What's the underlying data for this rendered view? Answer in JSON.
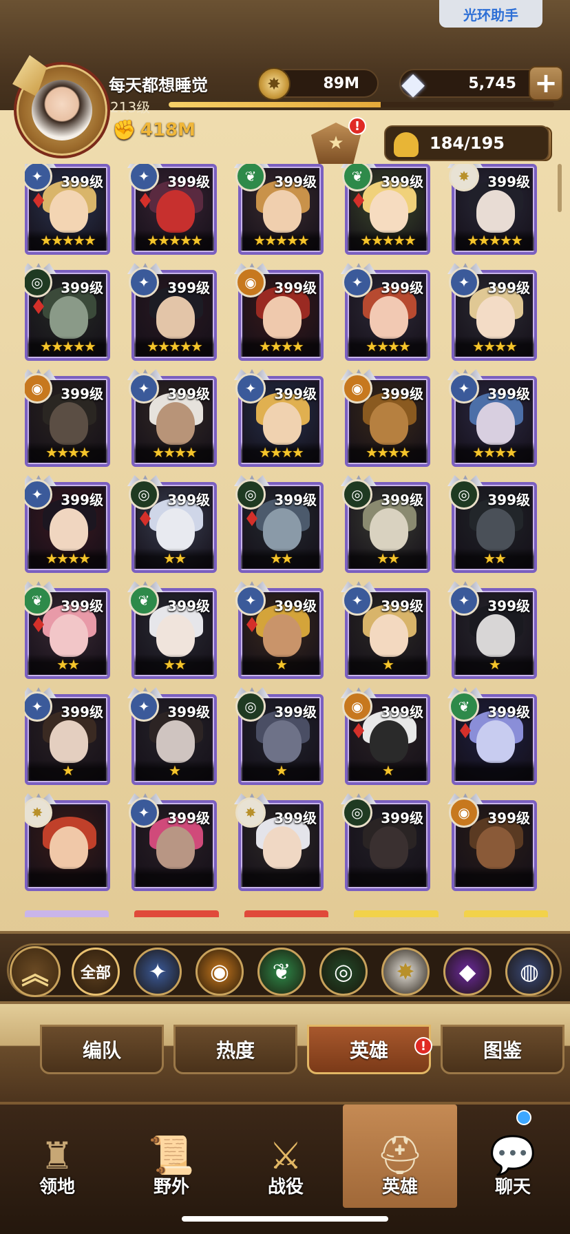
{
  "halo_button": "光环助手",
  "player": {
    "name": "每天都想睡觉",
    "level": "213级",
    "xp_fraction": 0.55,
    "power": "418M"
  },
  "resources": {
    "gold": "89M",
    "diamonds": "5,745"
  },
  "hero_capacity": "184/195",
  "rank_badge": "!",
  "heroes": [
    {
      "level": "399级",
      "stars": "★★★★★",
      "faction": "lightbearer",
      "skin": "#f3d5b3",
      "hair": "#d9b56a",
      "bg": "#2b3550",
      "gem": true
    },
    {
      "level": "399级",
      "stars": "★★★★★",
      "faction": "lightbearer",
      "skin": "#c7302e",
      "hair": "#5a2a40",
      "bg": "#3a2535",
      "gem": true
    },
    {
      "level": "399级",
      "stars": "★★★★★",
      "faction": "wilder",
      "skin": "#f0cfae",
      "hair": "#c9924a",
      "bg": "#3a2c30",
      "gem": false
    },
    {
      "level": "399级",
      "stars": "★★★★★",
      "faction": "wilder",
      "skin": "#f6dcc0",
      "hair": "#f0d17a",
      "bg": "#3d4a2c",
      "gem": true
    },
    {
      "level": "399级",
      "stars": "★★★★★",
      "faction": "celestial",
      "skin": "#e8dcd4",
      "hair": "#20202a",
      "bg": "#2a2a3a",
      "gem": false
    },
    {
      "level": "399级",
      "stars": "★★★★★",
      "faction": "graveborn",
      "skin": "#8a9a88",
      "hair": "#3b4a3a",
      "bg": "#252a25",
      "gem": true
    },
    {
      "level": "399级",
      "stars": "★★★★★",
      "faction": "lightbearer",
      "skin": "#e3c5a8",
      "hair": "#1c1c24",
      "bg": "#2a1a22",
      "gem": false
    },
    {
      "level": "399级",
      "stars": "★★★★",
      "faction": "mauler",
      "skin": "#efc9ad",
      "hair": "#9a2a22",
      "bg": "#3a1a1a",
      "gem": false
    },
    {
      "level": "399级",
      "stars": "★★★★",
      "faction": "lightbearer",
      "skin": "#f2c9b3",
      "hair": "#b74a30",
      "bg": "#2e2a38",
      "gem": false
    },
    {
      "level": "399级",
      "stars": "★★★★",
      "faction": "lightbearer",
      "skin": "#f3dcc6",
      "hair": "#e0c894",
      "bg": "#2c2c34",
      "gem": false
    },
    {
      "level": "399级",
      "stars": "★★★★",
      "faction": "mauler",
      "skin": "#5b4e44",
      "hair": "#2a2622",
      "bg": "#2a2420",
      "gem": false
    },
    {
      "level": "399级",
      "stars": "★★★★",
      "faction": "lightbearer",
      "skin": "#b89478",
      "hair": "#e6e2dc",
      "bg": "#332a26",
      "gem": false
    },
    {
      "level": "399级",
      "stars": "★★★★",
      "faction": "lightbearer",
      "skin": "#f0d2b0",
      "hair": "#e0b050",
      "bg": "#26304a",
      "gem": false
    },
    {
      "level": "399级",
      "stars": "★★★★",
      "faction": "mauler",
      "skin": "#b68040",
      "hair": "#8a5a20",
      "bg": "#3a2a1a",
      "gem": false
    },
    {
      "level": "399级",
      "stars": "★★★★",
      "faction": "lightbearer",
      "skin": "#d8cfe0",
      "hair": "#4c6fa8",
      "bg": "#2c2a44",
      "gem": false
    },
    {
      "level": "399级",
      "stars": "★★★★",
      "faction": "lightbearer",
      "skin": "#f0d6c0",
      "hair": "#1c1620",
      "bg": "#3a1820",
      "gem": false
    },
    {
      "level": "399级",
      "stars": "★★",
      "faction": "graveborn",
      "skin": "#e8eaf0",
      "hair": "#cfd6e8",
      "bg": "#3a4052",
      "gem": true
    },
    {
      "level": "399级",
      "stars": "★★",
      "faction": "graveborn",
      "skin": "#8a9aa8",
      "hair": "#4c5a6c",
      "bg": "#242a30",
      "gem": true
    },
    {
      "level": "399级",
      "stars": "★★",
      "faction": "graveborn",
      "skin": "#d9d2c0",
      "hair": "#8a8a70",
      "bg": "#3a3c34",
      "gem": false
    },
    {
      "level": "399级",
      "stars": "★★",
      "faction": "graveborn",
      "skin": "#4a5058",
      "hair": "#22262a",
      "bg": "#202428",
      "gem": false
    },
    {
      "level": "399级",
      "stars": "★★",
      "faction": "wilder",
      "skin": "#f2c6c8",
      "hair": "#e89aa8",
      "bg": "#3a2a34",
      "gem": true
    },
    {
      "level": "399级",
      "stars": "★★",
      "faction": "wilder",
      "skin": "#f0e4dc",
      "hair": "#e6e6ea",
      "bg": "#2a2c34",
      "gem": false
    },
    {
      "level": "399级",
      "stars": "★",
      "faction": "lightbearer",
      "skin": "#c9946a",
      "hair": "#d4a43a",
      "bg": "#3a2a1e",
      "gem": true
    },
    {
      "level": "399级",
      "stars": "★",
      "faction": "lightbearer",
      "skin": "#f3d9c0",
      "hair": "#d8b46a",
      "bg": "#2c2a26",
      "gem": false
    },
    {
      "level": "399级",
      "stars": "★",
      "faction": "lightbearer",
      "skin": "#d8d6d6",
      "hair": "#1a1a20",
      "bg": "#28282e",
      "gem": false
    },
    {
      "level": "399级",
      "stars": "★",
      "faction": "lightbearer",
      "skin": "#e4cfc0",
      "hair": "#3a2a22",
      "bg": "#2a2224",
      "gem": false
    },
    {
      "level": "399级",
      "stars": "★",
      "faction": "lightbearer",
      "skin": "#cfc4c0",
      "hair": "#2c2424",
      "bg": "#26242a",
      "gem": false
    },
    {
      "level": "399级",
      "stars": "★",
      "faction": "graveborn",
      "skin": "#6e7288",
      "hair": "#4a4e64",
      "bg": "#22242e",
      "gem": false
    },
    {
      "level": "399级",
      "stars": "★",
      "faction": "mauler",
      "skin": "#2a2a2a",
      "hair": "#e8e8e8",
      "bg": "#2a2224",
      "gem": true
    },
    {
      "level": "399级",
      "stars": "",
      "faction": "wilder",
      "skin": "#c8ccf0",
      "hair": "#8a8ed8",
      "bg": "#1e2040",
      "gem": true
    },
    {
      "level": "",
      "stars": "",
      "faction": "celestial",
      "skin": "#f0c8a8",
      "hair": "#c0402a",
      "bg": "#3a1c18",
      "gem": false
    },
    {
      "level": "399级",
      "stars": "",
      "faction": "lightbearer",
      "skin": "#b89684",
      "hair": "#d04a7a",
      "bg": "#2a2026",
      "gem": false
    },
    {
      "level": "399级",
      "stars": "",
      "faction": "celestial",
      "skin": "#f0d8c4",
      "hair": "#e4e4ea",
      "bg": "#2e2a28",
      "gem": false
    },
    {
      "level": "399级",
      "stars": "",
      "faction": "graveborn",
      "skin": "#3a3030",
      "hair": "#2a2424",
      "bg": "#222026",
      "gem": false
    },
    {
      "level": "399级",
      "stars": "",
      "faction": "mauler",
      "skin": "#8a5a38",
      "hair": "#5a3a22",
      "bg": "#2a1e18",
      "gem": false
    }
  ],
  "partial_row_colors": [
    "#c9b5ea",
    "#e04a3a",
    "#e04a3a",
    "#f2d24a",
    "#f2d24a"
  ],
  "faction_filters": {
    "all_label": "全部",
    "items": [
      {
        "name": "lightbearer",
        "color": "#3b5a9a",
        "glyph": "✦"
      },
      {
        "name": "mauler",
        "color": "#c7781e",
        "glyph": "◉"
      },
      {
        "name": "wilder",
        "color": "#2e8a4a",
        "glyph": "❦"
      },
      {
        "name": "graveborn",
        "color": "#234a2a",
        "glyph": "◎"
      },
      {
        "name": "celestial",
        "color": "#e6e2da",
        "glyph": "✸"
      },
      {
        "name": "hypogean",
        "color": "#6a2a9a",
        "glyph": "◆"
      },
      {
        "name": "dimensional",
        "color": "#3a4a7a",
        "glyph": "◍"
      }
    ]
  },
  "faction_colors": {
    "lightbearer": "#3b5a9a",
    "mauler": "#c7781e",
    "wilder": "#2e8a4a",
    "graveborn": "#1f3a22",
    "celestial": "#e8e2d4"
  },
  "subtabs": {
    "formation": "编队",
    "popularity": "热度",
    "heroes": "英雄",
    "codex": "图鉴",
    "heroes_alert": "!"
  },
  "nav": {
    "territory": "领地",
    "wild": "野外",
    "campaign": "战役",
    "heroes": "英雄",
    "chat": "聊天"
  }
}
